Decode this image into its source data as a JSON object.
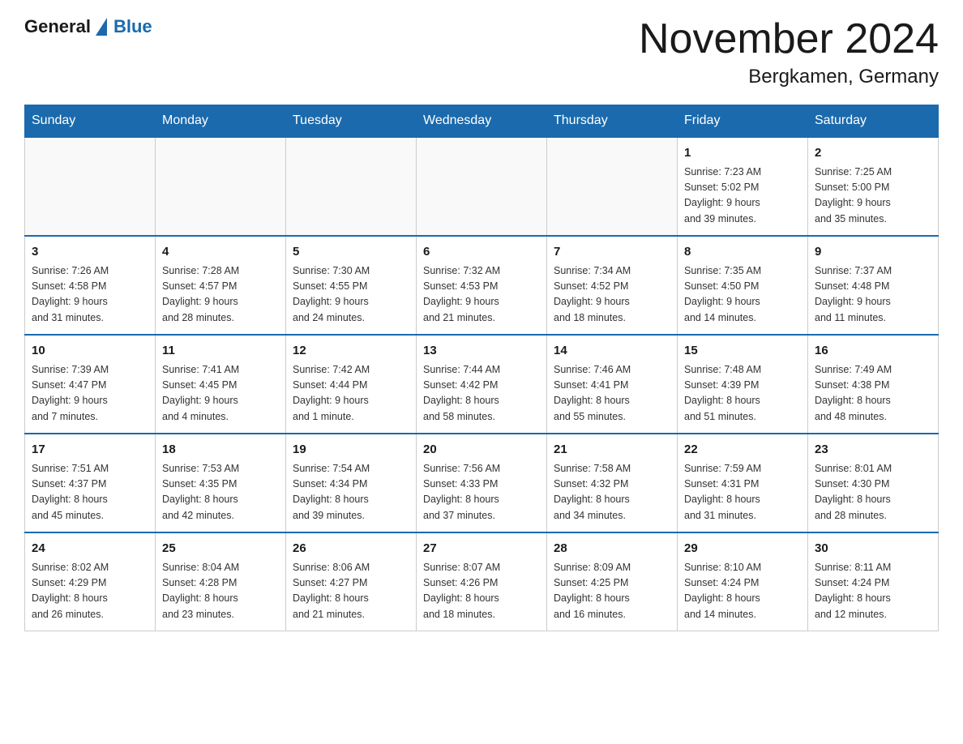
{
  "header": {
    "logo_general": "General",
    "logo_blue": "Blue",
    "month_title": "November 2024",
    "location": "Bergkamen, Germany"
  },
  "weekdays": [
    "Sunday",
    "Monday",
    "Tuesday",
    "Wednesday",
    "Thursday",
    "Friday",
    "Saturday"
  ],
  "weeks": [
    [
      {
        "day": "",
        "info": ""
      },
      {
        "day": "",
        "info": ""
      },
      {
        "day": "",
        "info": ""
      },
      {
        "day": "",
        "info": ""
      },
      {
        "day": "",
        "info": ""
      },
      {
        "day": "1",
        "info": "Sunrise: 7:23 AM\nSunset: 5:02 PM\nDaylight: 9 hours\nand 39 minutes."
      },
      {
        "day": "2",
        "info": "Sunrise: 7:25 AM\nSunset: 5:00 PM\nDaylight: 9 hours\nand 35 minutes."
      }
    ],
    [
      {
        "day": "3",
        "info": "Sunrise: 7:26 AM\nSunset: 4:58 PM\nDaylight: 9 hours\nand 31 minutes."
      },
      {
        "day": "4",
        "info": "Sunrise: 7:28 AM\nSunset: 4:57 PM\nDaylight: 9 hours\nand 28 minutes."
      },
      {
        "day": "5",
        "info": "Sunrise: 7:30 AM\nSunset: 4:55 PM\nDaylight: 9 hours\nand 24 minutes."
      },
      {
        "day": "6",
        "info": "Sunrise: 7:32 AM\nSunset: 4:53 PM\nDaylight: 9 hours\nand 21 minutes."
      },
      {
        "day": "7",
        "info": "Sunrise: 7:34 AM\nSunset: 4:52 PM\nDaylight: 9 hours\nand 18 minutes."
      },
      {
        "day": "8",
        "info": "Sunrise: 7:35 AM\nSunset: 4:50 PM\nDaylight: 9 hours\nand 14 minutes."
      },
      {
        "day": "9",
        "info": "Sunrise: 7:37 AM\nSunset: 4:48 PM\nDaylight: 9 hours\nand 11 minutes."
      }
    ],
    [
      {
        "day": "10",
        "info": "Sunrise: 7:39 AM\nSunset: 4:47 PM\nDaylight: 9 hours\nand 7 minutes."
      },
      {
        "day": "11",
        "info": "Sunrise: 7:41 AM\nSunset: 4:45 PM\nDaylight: 9 hours\nand 4 minutes."
      },
      {
        "day": "12",
        "info": "Sunrise: 7:42 AM\nSunset: 4:44 PM\nDaylight: 9 hours\nand 1 minute."
      },
      {
        "day": "13",
        "info": "Sunrise: 7:44 AM\nSunset: 4:42 PM\nDaylight: 8 hours\nand 58 minutes."
      },
      {
        "day": "14",
        "info": "Sunrise: 7:46 AM\nSunset: 4:41 PM\nDaylight: 8 hours\nand 55 minutes."
      },
      {
        "day": "15",
        "info": "Sunrise: 7:48 AM\nSunset: 4:39 PM\nDaylight: 8 hours\nand 51 minutes."
      },
      {
        "day": "16",
        "info": "Sunrise: 7:49 AM\nSunset: 4:38 PM\nDaylight: 8 hours\nand 48 minutes."
      }
    ],
    [
      {
        "day": "17",
        "info": "Sunrise: 7:51 AM\nSunset: 4:37 PM\nDaylight: 8 hours\nand 45 minutes."
      },
      {
        "day": "18",
        "info": "Sunrise: 7:53 AM\nSunset: 4:35 PM\nDaylight: 8 hours\nand 42 minutes."
      },
      {
        "day": "19",
        "info": "Sunrise: 7:54 AM\nSunset: 4:34 PM\nDaylight: 8 hours\nand 39 minutes."
      },
      {
        "day": "20",
        "info": "Sunrise: 7:56 AM\nSunset: 4:33 PM\nDaylight: 8 hours\nand 37 minutes."
      },
      {
        "day": "21",
        "info": "Sunrise: 7:58 AM\nSunset: 4:32 PM\nDaylight: 8 hours\nand 34 minutes."
      },
      {
        "day": "22",
        "info": "Sunrise: 7:59 AM\nSunset: 4:31 PM\nDaylight: 8 hours\nand 31 minutes."
      },
      {
        "day": "23",
        "info": "Sunrise: 8:01 AM\nSunset: 4:30 PM\nDaylight: 8 hours\nand 28 minutes."
      }
    ],
    [
      {
        "day": "24",
        "info": "Sunrise: 8:02 AM\nSunset: 4:29 PM\nDaylight: 8 hours\nand 26 minutes."
      },
      {
        "day": "25",
        "info": "Sunrise: 8:04 AM\nSunset: 4:28 PM\nDaylight: 8 hours\nand 23 minutes."
      },
      {
        "day": "26",
        "info": "Sunrise: 8:06 AM\nSunset: 4:27 PM\nDaylight: 8 hours\nand 21 minutes."
      },
      {
        "day": "27",
        "info": "Sunrise: 8:07 AM\nSunset: 4:26 PM\nDaylight: 8 hours\nand 18 minutes."
      },
      {
        "day": "28",
        "info": "Sunrise: 8:09 AM\nSunset: 4:25 PM\nDaylight: 8 hours\nand 16 minutes."
      },
      {
        "day": "29",
        "info": "Sunrise: 8:10 AM\nSunset: 4:24 PM\nDaylight: 8 hours\nand 14 minutes."
      },
      {
        "day": "30",
        "info": "Sunrise: 8:11 AM\nSunset: 4:24 PM\nDaylight: 8 hours\nand 12 minutes."
      }
    ]
  ]
}
